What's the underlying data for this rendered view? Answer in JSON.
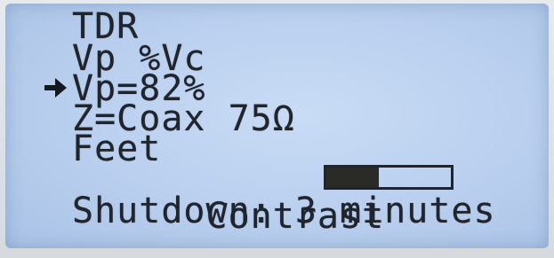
{
  "menu": {
    "title": "TDR",
    "items": [
      {
        "label": "Vp %Vc"
      },
      {
        "label": "Vp=82%",
        "selected": true
      },
      {
        "label": "Z=Coax 75Ω"
      },
      {
        "label": "Feet"
      },
      {
        "label": "Contrast",
        "level": 0.42
      },
      {
        "label": "Shutdown:",
        "value": "3 minutes"
      }
    ]
  },
  "icons": {
    "cursor": "right-arrow-cursor-icon"
  },
  "colors": {
    "lcd_background": "#bcd2f0",
    "lcd_text": "#20252d"
  }
}
